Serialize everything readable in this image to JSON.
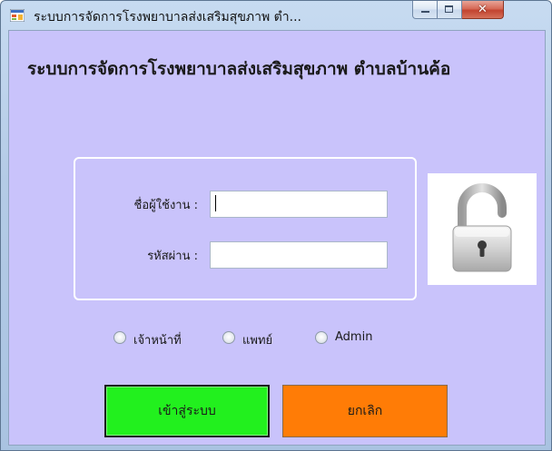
{
  "window": {
    "title": "ระบบการจัดการโรงพยาบาลส่งเสริมสุขภาพ ตำ...",
    "minimize_icon": "minimize-icon",
    "maximize_icon": "maximize-icon",
    "close_icon": "close-icon",
    "close_glyph": "✕"
  },
  "heading": "ระบบการจัดการโรงพยาบาลส่งเสริมสุขภาพ ตำบลบ้านค้อ",
  "form": {
    "username_label": "ชื่อผู้ใช้งาน :",
    "username_value": "",
    "password_label": "รหัสผ่าน :",
    "password_value": ""
  },
  "lock_icon": "padlock-icon",
  "roles": [
    {
      "label": "เจ้าหน้าที่",
      "selected": false
    },
    {
      "label": "แพทย์",
      "selected": false
    },
    {
      "label": "Admin",
      "selected": false
    }
  ],
  "buttons": {
    "enter_label": "เข้าสู่ระบบ",
    "cancel_label": "ยกเลิก"
  },
  "colors": {
    "client_bg": "#c9c3fb",
    "enter_button": "#22f01e",
    "cancel_button": "#ff7c06"
  }
}
